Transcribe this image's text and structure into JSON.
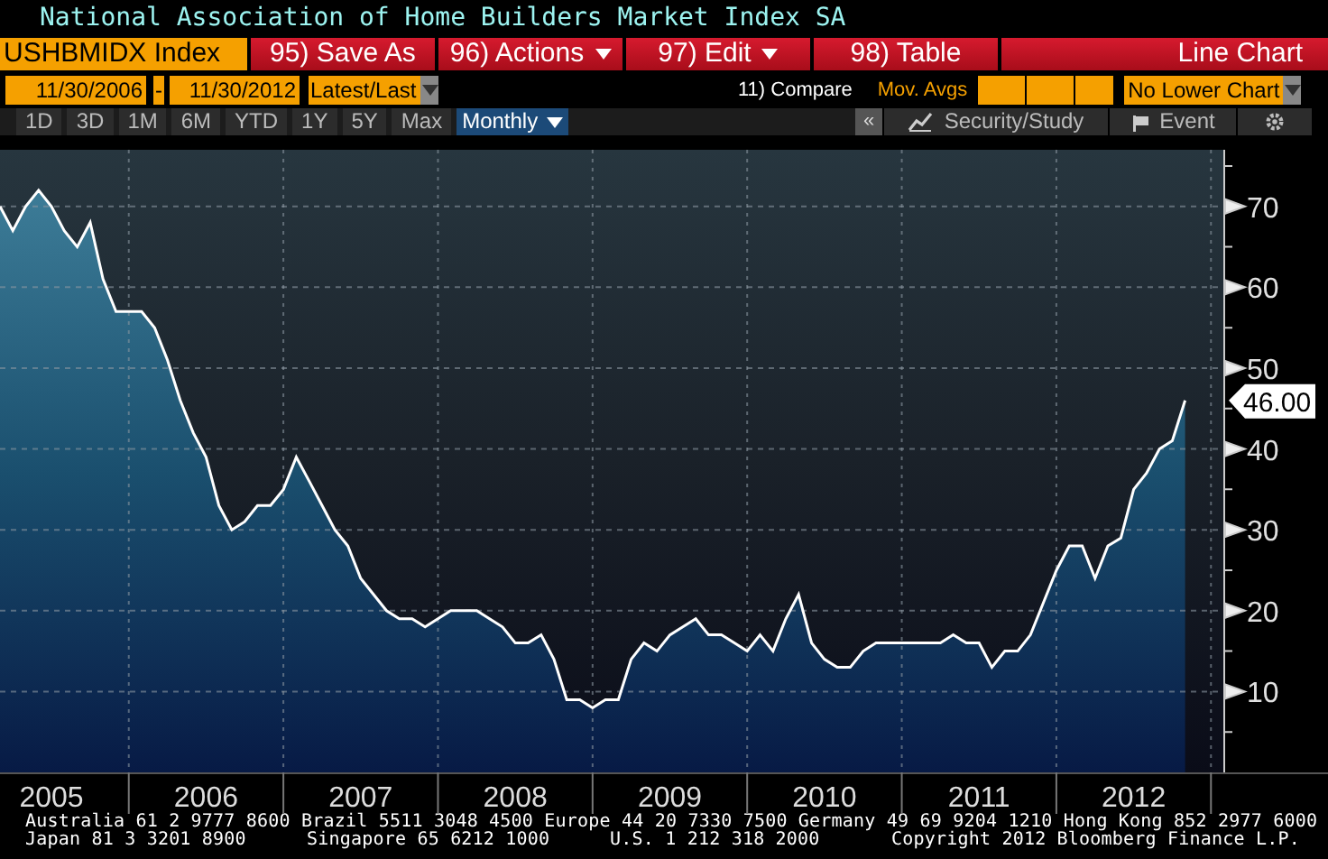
{
  "window": {
    "title": "National Association of Home Builders Market Index SA"
  },
  "toolbar": {
    "security": "USHBMIDX Index",
    "buttons": [
      {
        "label": "95) Save As",
        "dropdown": false
      },
      {
        "label": "96) Actions",
        "dropdown": true
      },
      {
        "label": "97) Edit",
        "dropdown": true
      },
      {
        "label": "98) Table",
        "dropdown": false
      }
    ],
    "chart_type": "Line Chart"
  },
  "date_bar": {
    "start": "11/30/2006",
    "separator": "-",
    "end": "11/30/2012",
    "mode": "Latest/Last",
    "compare": "11) Compare",
    "mov_avgs": "Mov. Avgs",
    "lower_chart": "No Lower Chart"
  },
  "periods": [
    {
      "label": "1D",
      "selected": false,
      "dropdown": false
    },
    {
      "label": "3D",
      "selected": false,
      "dropdown": false
    },
    {
      "label": "1M",
      "selected": false,
      "dropdown": false
    },
    {
      "label": "6M",
      "selected": false,
      "dropdown": false
    },
    {
      "label": "YTD",
      "selected": false,
      "dropdown": false
    },
    {
      "label": "1Y",
      "selected": false,
      "dropdown": false
    },
    {
      "label": "5Y",
      "selected": false,
      "dropdown": false
    },
    {
      "label": "Max",
      "selected": false,
      "dropdown": false
    },
    {
      "label": "Monthly",
      "selected": true,
      "dropdown": true
    }
  ],
  "tools": {
    "collapse": "«",
    "items": [
      {
        "kind": "study",
        "label": "Security/Study"
      },
      {
        "kind": "event",
        "label": "Event"
      },
      {
        "kind": "settings"
      }
    ]
  },
  "chart": {
    "chart_data": {
      "type": "area",
      "grid": true,
      "x": [
        2005.167,
        2005.25,
        2005.333,
        2005.417,
        2005.5,
        2005.583,
        2005.667,
        2005.75,
        2005.833,
        2005.917,
        2006,
        2006.083,
        2006.167,
        2006.25,
        2006.333,
        2006.417,
        2006.5,
        2006.583,
        2006.667,
        2006.75,
        2006.833,
        2006.917,
        2007,
        2007.083,
        2007.167,
        2007.25,
        2007.333,
        2007.417,
        2007.5,
        2007.583,
        2007.667,
        2007.75,
        2007.833,
        2007.917,
        2008,
        2008.083,
        2008.167,
        2008.25,
        2008.333,
        2008.417,
        2008.5,
        2008.583,
        2008.667,
        2008.75,
        2008.833,
        2008.917,
        2009,
        2009.083,
        2009.167,
        2009.25,
        2009.333,
        2009.417,
        2009.5,
        2009.583,
        2009.667,
        2009.75,
        2009.833,
        2009.917,
        2010,
        2010.083,
        2010.167,
        2010.25,
        2010.333,
        2010.417,
        2010.5,
        2010.583,
        2010.667,
        2010.75,
        2010.833,
        2010.917,
        2011,
        2011.083,
        2011.167,
        2011.25,
        2011.333,
        2011.417,
        2011.5,
        2011.583,
        2011.667,
        2011.75,
        2011.833,
        2011.917,
        2012,
        2012.083,
        2012.167,
        2012.25,
        2012.333,
        2012.417,
        2012.5,
        2012.583,
        2012.667,
        2012.75,
        2012.833
      ],
      "xlim": [
        2005.167,
        2013.757
      ],
      "series": [
        {
          "color": "#ffffff",
          "values": [
            70,
            67,
            70,
            72,
            70,
            67,
            65,
            68,
            61,
            57,
            57,
            57,
            55,
            51,
            46,
            42,
            39,
            33,
            30,
            31,
            33,
            33,
            35,
            39,
            36,
            33,
            30,
            28,
            24,
            22,
            20,
            19,
            19,
            18,
            19,
            20,
            20,
            20,
            19,
            18,
            16,
            16,
            17,
            14,
            9,
            9,
            8,
            9,
            9,
            14,
            16,
            15,
            17,
            18,
            19,
            17,
            17,
            16,
            15,
            17,
            15,
            19,
            22,
            16,
            14,
            13,
            13,
            15,
            16,
            16,
            16,
            16,
            16,
            16,
            17,
            16,
            16,
            13,
            15,
            15,
            17,
            21,
            25,
            28,
            28,
            24,
            28,
            29,
            35,
            37,
            40,
            41,
            46
          ]
        }
      ],
      "ylim": [
        0,
        77
      ],
      "yticks": [
        10,
        20,
        30,
        40,
        50,
        60,
        70
      ],
      "xticks": [
        {
          "value": 2005.5,
          "label": "2005"
        },
        {
          "value": 2006.5,
          "label": "2006"
        },
        {
          "value": 2007.5,
          "label": "2007"
        },
        {
          "value": 2008.5,
          "label": "2008"
        },
        {
          "value": 2009.5,
          "label": "2009"
        },
        {
          "value": 2010.5,
          "label": "2010"
        },
        {
          "value": 2011.5,
          "label": "2011"
        },
        {
          "value": 2012.5,
          "label": "2012"
        }
      ],
      "annotations": [
        {
          "text": "46.00"
        }
      ]
    }
  },
  "footer": {
    "line_1": "Australia 61 2 9777 8600 Brazil 5511 3048 4500 Europe 44 20 7330 7500 Germany 49 69 9204 1210 Hong Kong 852 2977 6000",
    "line_2": [
      "Japan 81 3 3201 8900",
      "Singapore 65 6212 1000",
      "U.S. 1 212 318 2000",
      "Copyright 2012 Bloomberg Finance L.P."
    ]
  }
}
